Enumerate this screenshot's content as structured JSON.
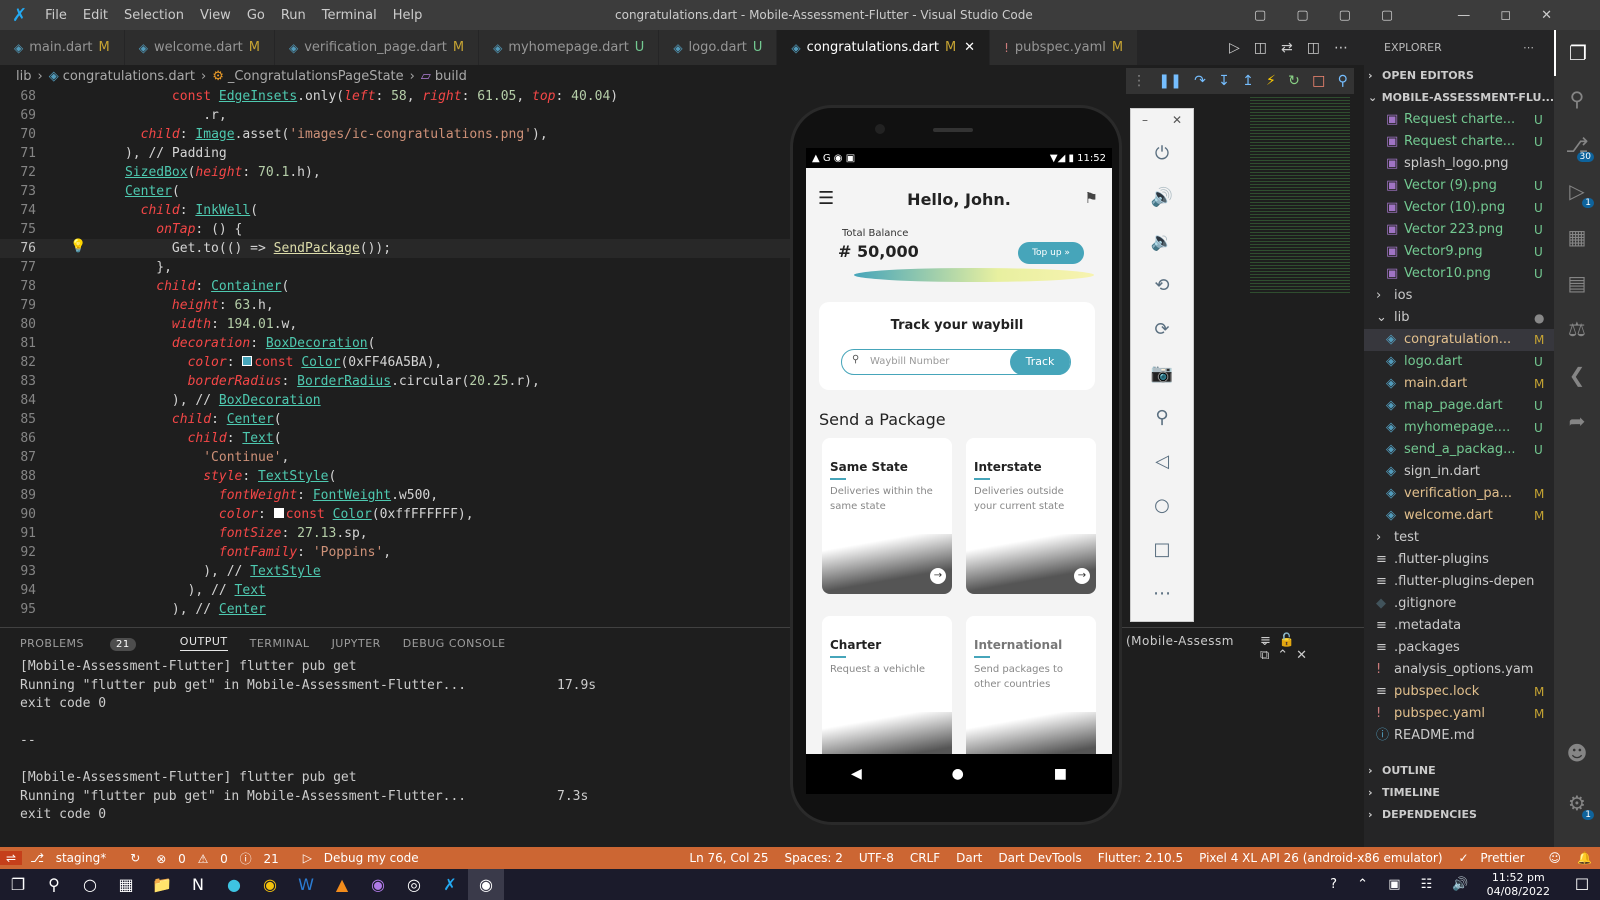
{
  "window": {
    "title": "congratulations.dart - Mobile-Assessment-Flutter - Visual Studio Code",
    "menu": [
      "File",
      "Edit",
      "Selection",
      "View",
      "Go",
      "Run",
      "Terminal",
      "Help"
    ]
  },
  "tabs": [
    {
      "label": "main.dart",
      "status": "M"
    },
    {
      "label": "welcome.dart",
      "status": "M"
    },
    {
      "label": "verification_page.dart",
      "status": "M"
    },
    {
      "label": "myhomepage.dart",
      "status": "U"
    },
    {
      "label": "logo.dart",
      "status": "U"
    },
    {
      "label": "congratulations.dart",
      "status": "M"
    },
    {
      "label": "pubspec.yaml",
      "status": "M"
    }
  ],
  "breadcrumb": [
    "lib",
    "congratulations.dart",
    "_CongratulationsPageState",
    "build"
  ],
  "editor": {
    "lines": [
      {
        "n": "68",
        "t": "            const EdgeInsets.only(left: 58, right: 61.05, top: 40.04)"
      },
      {
        "n": "69",
        "t": "                .r,"
      },
      {
        "n": "70",
        "t": "        child: Image.asset('images/ic-congratulations.png'),"
      },
      {
        "n": "71",
        "t": "      ), // Padding"
      },
      {
        "n": "72",
        "t": "      SizedBox(height: 70.1.h),"
      },
      {
        "n": "73",
        "t": "      Center("
      },
      {
        "n": "74",
        "t": "        child: InkWell("
      },
      {
        "n": "75",
        "t": "          onTap: () {"
      },
      {
        "n": "76",
        "t": "            Get.to(() => SendPackage());"
      },
      {
        "n": "77",
        "t": "          },"
      },
      {
        "n": "78",
        "t": "          child: Container("
      },
      {
        "n": "79",
        "t": "            height: 63.h,"
      },
      {
        "n": "80",
        "t": "            width: 194.01.w,"
      },
      {
        "n": "81",
        "t": "            decoration: BoxDecoration("
      },
      {
        "n": "82",
        "t": "              color: ■const Color(0xFF46A5BA),"
      },
      {
        "n": "83",
        "t": "              borderRadius: BorderRadius.circular(20.25.r),"
      },
      {
        "n": "84",
        "t": "            ), // BoxDecoration"
      },
      {
        "n": "85",
        "t": "            child: Center("
      },
      {
        "n": "86",
        "t": "              child: Text("
      },
      {
        "n": "87",
        "t": "                'Continue',"
      },
      {
        "n": "88",
        "t": "                style: TextStyle("
      },
      {
        "n": "89",
        "t": "                  fontWeight: FontWeight.w500,"
      },
      {
        "n": "90",
        "t": "                  color: □const Color(0xffFFFFFF),"
      },
      {
        "n": "91",
        "t": "                  fontSize: 27.13.sp,"
      },
      {
        "n": "92",
        "t": "                  fontFamily: 'Poppins',"
      },
      {
        "n": "93",
        "t": "                ), // TextStyle"
      },
      {
        "n": "94",
        "t": "              ), // Text"
      },
      {
        "n": "95",
        "t": "            ), // Center"
      }
    ]
  },
  "panel": {
    "tabs": [
      "PROBLEMS",
      "OUTPUT",
      "TERMINAL",
      "JUPYTER",
      "DEBUG CONSOLE"
    ],
    "problems_count": "21",
    "channel": "(Mobile-Assessm",
    "output": [
      {
        "text": "[Mobile-Assessment-Flutter] flutter pub get",
        "time": ""
      },
      {
        "text": "Running \"flutter pub get\" in Mobile-Assessment-Flutter...",
        "time": "17.9s"
      },
      {
        "text": "exit code 0",
        "time": ""
      },
      {
        "text": "",
        "time": ""
      },
      {
        "text": "--",
        "time": ""
      },
      {
        "text": "",
        "time": ""
      },
      {
        "text": "[Mobile-Assessment-Flutter] flutter pub get",
        "time": ""
      },
      {
        "text": "Running \"flutter pub get\" in Mobile-Assessment-Flutter...",
        "time": "7.3s"
      },
      {
        "text": "exit code 0",
        "time": ""
      }
    ]
  },
  "status": {
    "branch": "staging*",
    "errors": "0",
    "warnings": "0",
    "info": "21",
    "debug": "Debug my code",
    "pos": "Ln 76, Col 25",
    "spaces": "Spaces: 2",
    "enc": "UTF-8",
    "eol": "CRLF",
    "lang": "Dart",
    "devtools": "Dart DevTools",
    "flutter": "Flutter: 2.10.5",
    "device": "Pixel 4 XL API 26 (android-x86 emulator)",
    "prettier": "Prettier"
  },
  "taskbar": {
    "time": "11:52 pm",
    "date": "04/08/2022"
  },
  "explorer": {
    "title": "EXPLORER",
    "open_editors": "OPEN EDITORS",
    "project": "MOBILE-ASSESSMENT-FLU...",
    "files": [
      {
        "n": "Request charte...",
        "s": "U",
        "d": 1,
        "i": "img"
      },
      {
        "n": "Request charte...",
        "s": "U",
        "d": 1,
        "i": "img"
      },
      {
        "n": "splash_logo.png",
        "s": "",
        "d": 1,
        "i": "img"
      },
      {
        "n": "Vector (9).png",
        "s": "U",
        "d": 1,
        "i": "img"
      },
      {
        "n": "Vector (10).png",
        "s": "U",
        "d": 1,
        "i": "img"
      },
      {
        "n": "Vector 223.png",
        "s": "U",
        "d": 1,
        "i": "img"
      },
      {
        "n": "Vector9.png",
        "s": "U",
        "d": 1,
        "i": "img"
      },
      {
        "n": "Vector10.png",
        "s": "U",
        "d": 1,
        "i": "img"
      },
      {
        "n": "ios",
        "s": "",
        "d": 0,
        "i": "fold"
      },
      {
        "n": "lib",
        "s": "●",
        "d": 0,
        "i": "open"
      },
      {
        "n": "congratulation...",
        "s": "M",
        "d": 1,
        "i": "dart"
      },
      {
        "n": "logo.dart",
        "s": "U",
        "d": 1,
        "i": "dart"
      },
      {
        "n": "main.dart",
        "s": "M",
        "d": 1,
        "i": "dart"
      },
      {
        "n": "map_page.dart",
        "s": "U",
        "d": 1,
        "i": "dart"
      },
      {
        "n": "myhomepage....",
        "s": "U",
        "d": 1,
        "i": "dart"
      },
      {
        "n": "send_a_packag...",
        "s": "U",
        "d": 1,
        "i": "dart"
      },
      {
        "n": "sign_in.dart",
        "s": "",
        "d": 1,
        "i": "dart"
      },
      {
        "n": "verification_pa...",
        "s": "M",
        "d": 1,
        "i": "dart"
      },
      {
        "n": "welcome.dart",
        "s": "M",
        "d": 1,
        "i": "dart"
      },
      {
        "n": "test",
        "s": "",
        "d": 0,
        "i": "fold"
      },
      {
        "n": ".flutter-plugins",
        "s": "",
        "d": 0,
        "i": "txt"
      },
      {
        "n": ".flutter-plugins-depen...",
        "s": "",
        "d": 0,
        "i": "txt"
      },
      {
        "n": ".gitignore",
        "s": "",
        "d": 0,
        "i": "git"
      },
      {
        "n": ".metadata",
        "s": "",
        "d": 0,
        "i": "txt"
      },
      {
        "n": ".packages",
        "s": "",
        "d": 0,
        "i": "txt"
      },
      {
        "n": "analysis_options.yaml",
        "s": "",
        "d": 0,
        "i": "yaml"
      },
      {
        "n": "pubspec.lock",
        "s": "M",
        "d": 0,
        "i": "txt"
      },
      {
        "n": "pubspec.yaml",
        "s": "M",
        "d": 0,
        "i": "yaml"
      },
      {
        "n": "README.md",
        "s": "",
        "d": 0,
        "i": "info"
      }
    ],
    "sections": [
      "OUTLINE",
      "TIMELINE",
      "DEPENDENCIES"
    ]
  },
  "app": {
    "time": "11:52",
    "greeting": "Hello, John.",
    "balance_label": "Total Balance",
    "balance": "# 50,000",
    "topup": "Top up",
    "track_title": "Track your waybill",
    "waybill_placeholder": "Waybill Number",
    "track_btn": "Track",
    "send_title": "Send a Package",
    "cards": [
      {
        "title": "Same State",
        "desc": "Deliveries within the same state"
      },
      {
        "title": "Interstate",
        "desc": "Deliveries outside your current state"
      },
      {
        "title": "Charter",
        "desc": "Request a vehichle"
      },
      {
        "title": "International",
        "desc": "Send packages to other countries"
      }
    ]
  },
  "colors": {
    "accent": "#46A5BA",
    "status": "#cc6633"
  }
}
